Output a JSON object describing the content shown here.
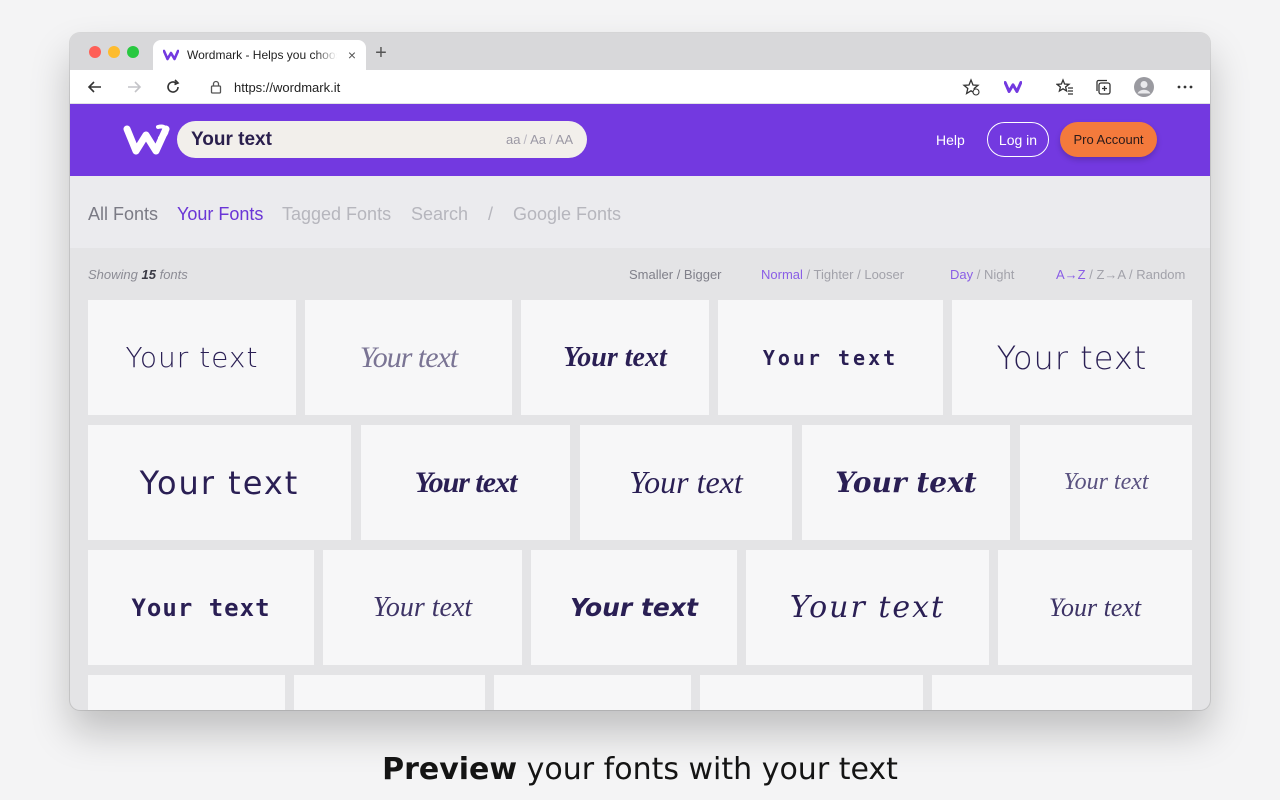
{
  "browser": {
    "tab_title": "Wordmark - Helps you choose fonts",
    "tab_close": "×",
    "new_tab": "+",
    "url": "https://wordmark.it"
  },
  "header": {
    "text_value": "Your text",
    "case_lower": "aa",
    "case_title": "Aa",
    "case_upper": "AA",
    "separator": "/",
    "help": "Help",
    "login": "Log in",
    "pro": "Pro Account"
  },
  "nav": {
    "all_fonts": "All Fonts",
    "your_fonts": "Your Fonts",
    "tagged_fonts": "Tagged Fonts",
    "search": "Search",
    "divider": "/",
    "google_fonts": "Google Fonts"
  },
  "controls": {
    "showing_prefix": "Showing",
    "count": "15",
    "showing_suffix": "fonts",
    "smaller": "Smaller",
    "bigger": "Bigger",
    "normal": "Normal",
    "tighter": "Tighter",
    "looser": "Looser",
    "day": "Day",
    "night": "Night",
    "az": "A→Z",
    "za": "Z→A",
    "random": "Random",
    "sep": " / "
  },
  "cards": [
    "Your text",
    "Your text",
    "Your text",
    "Your text",
    "Your text",
    "Your text",
    "Your text",
    "Your text",
    "Your text",
    "Your text",
    "Your text",
    "Your text",
    "Your text",
    "Your text",
    "Your text"
  ],
  "caption": {
    "bold": "Preview",
    "rest": " your fonts with your text"
  },
  "colors": {
    "brand_purple": "#7339e0",
    "accent_orange": "#f47a3c",
    "active_nav": "#6a35d6"
  }
}
